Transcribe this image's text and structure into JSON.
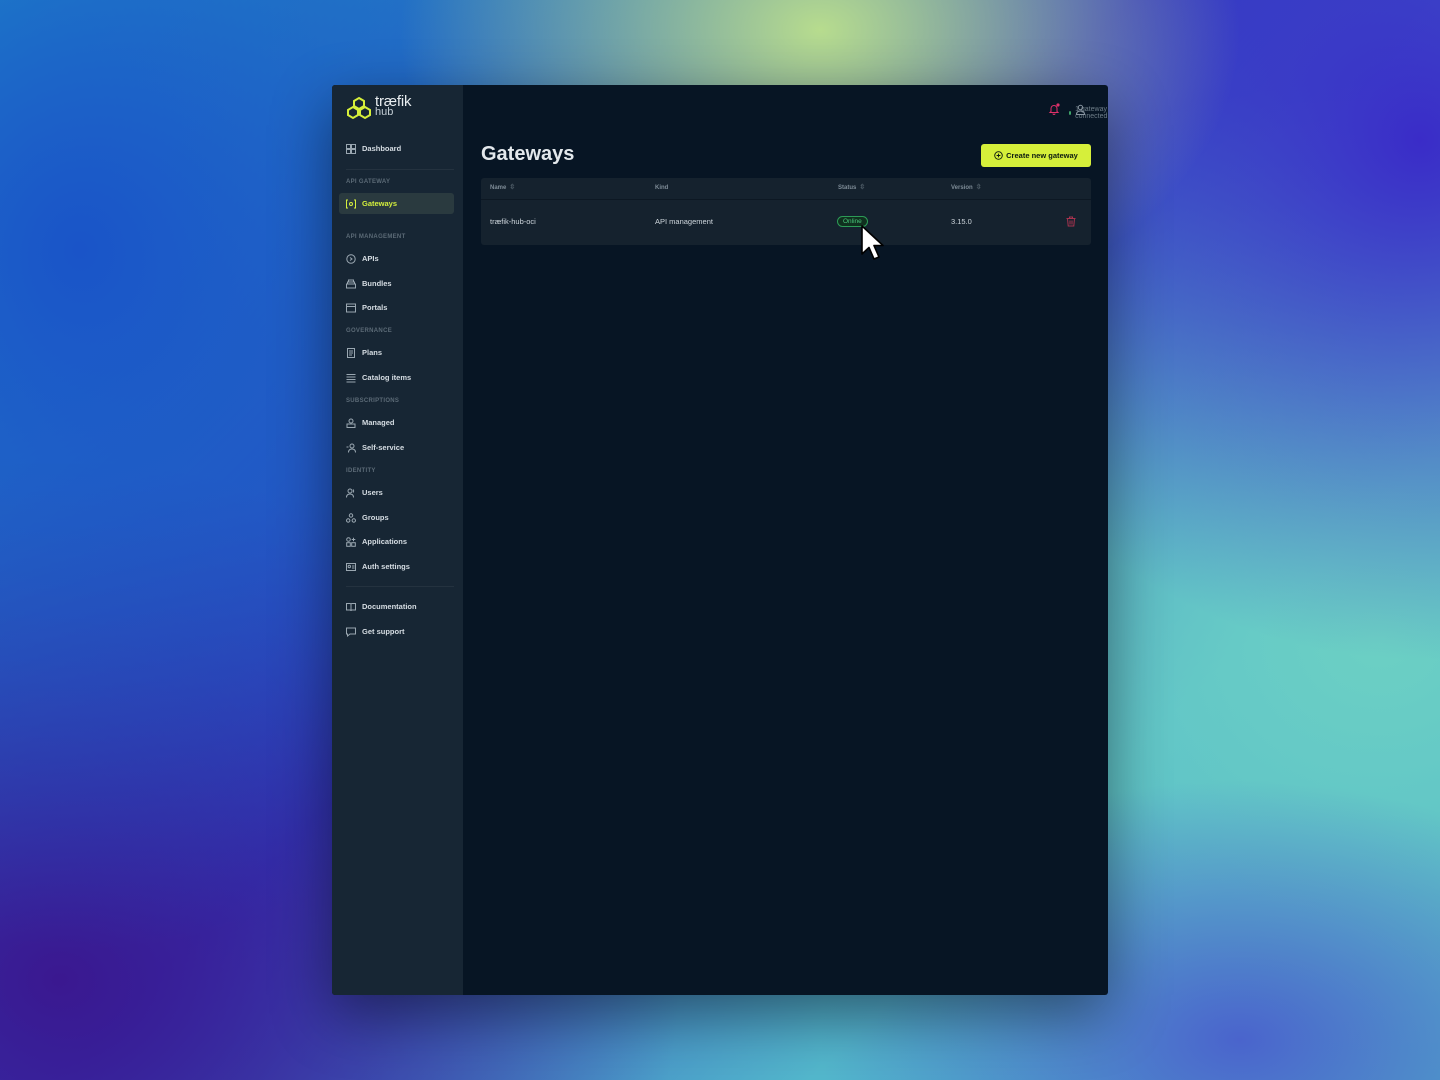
{
  "app": {
    "logo_line1": "træfik",
    "logo_line2": "hub",
    "brand_color": "#d6ef3a"
  },
  "sidebar": {
    "dashboard": "Dashboard",
    "sections": {
      "api_gateway": "API GATEWAY",
      "api_management": "API MANAGEMENT",
      "governance": "GOVERNANCE",
      "subscriptions": "SUBSCRIPTIONS",
      "identity": "IDENTITY"
    },
    "items": {
      "gateways": "Gateways",
      "apis": "APIs",
      "bundles": "Bundles",
      "portals": "Portals",
      "plans": "Plans",
      "catalog_items": "Catalog items",
      "managed": "Managed",
      "self_service": "Self-service",
      "users": "Users",
      "groups": "Groups",
      "applications": "Applications",
      "auth_settings": "Auth settings",
      "documentation": "Documentation",
      "get_support": "Get support"
    },
    "active_item": "Gateways"
  },
  "topbar": {
    "status": "1 gateway connected",
    "status_color": "#3fa86a",
    "notification_icon": "bell-icon",
    "user_icon": "user-icon"
  },
  "main": {
    "title": "Gateways",
    "create_button": "Create new gateway",
    "table": {
      "columns": [
        "Name",
        "Kind",
        "Status",
        "Version"
      ],
      "rows": [
        {
          "name": "træfik-hub-oci",
          "kind": "API management",
          "status": "Online",
          "version": "3.15.0"
        }
      ]
    }
  }
}
